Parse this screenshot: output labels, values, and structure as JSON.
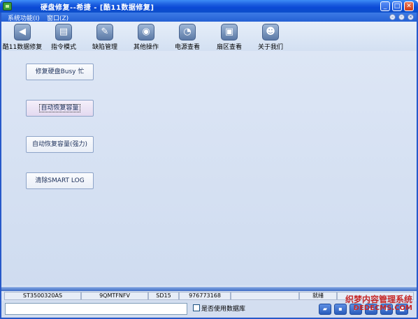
{
  "window": {
    "title": "硬盘修复--希捷 - [酷11数据修复]",
    "min_glyph": "_",
    "max_glyph": "□",
    "close_glyph": "✕"
  },
  "menubar": {
    "items": [
      {
        "label": "系统功能(I)"
      },
      {
        "label": "窗口(Z)"
      }
    ]
  },
  "toolbar": {
    "items": [
      {
        "label": "酷11数据修复",
        "icon": "back-arrow-icon"
      },
      {
        "label": "指令模式",
        "icon": "document-icon"
      },
      {
        "label": "缺陷管理",
        "icon": "wrench-icon"
      },
      {
        "label": "其他操作",
        "icon": "disk-icon"
      },
      {
        "label": "电源查看",
        "icon": "power-icon"
      },
      {
        "label": "扇区查看",
        "icon": "window-icon"
      },
      {
        "label": "关于我们",
        "icon": "person-icon"
      }
    ]
  },
  "actions": {
    "buttons": [
      {
        "label": "修复硬盘Busy 忙"
      },
      {
        "label": "自动恢复容量"
      },
      {
        "label": "自动恢复容量(强力)"
      },
      {
        "label": "清除SMART LOG"
      }
    ]
  },
  "status": {
    "model": "ST3500320AS",
    "serial": "9QMTFNFV",
    "firmware": "SD15",
    "capacity": "976773168",
    "state": "就绪"
  },
  "bottom": {
    "use_db_label": "是否使用数据库",
    "use_db_checked": false
  },
  "watermark": {
    "line1": "织梦内容管理系统",
    "line2": "DEDECMS.COM"
  },
  "colors": {
    "titlebar": "#0a49d6",
    "client": "#d9e4f4",
    "watermark": "#c62828"
  }
}
